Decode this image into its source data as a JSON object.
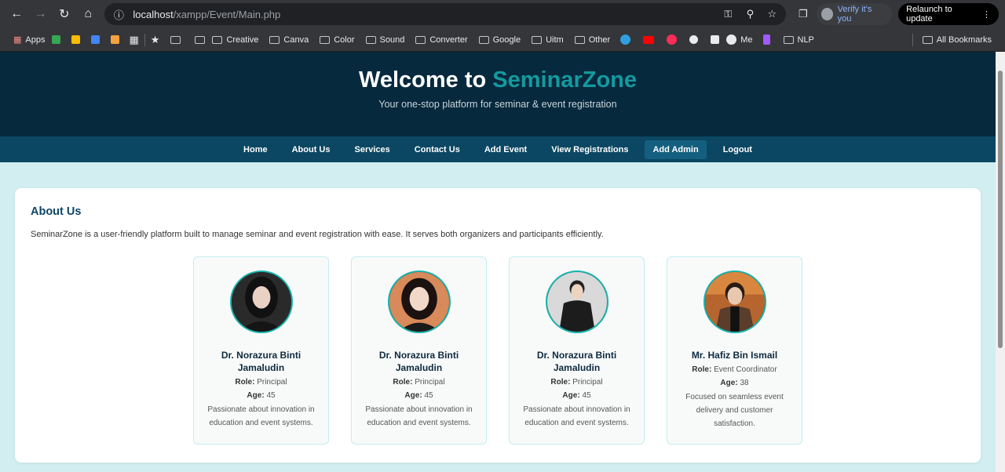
{
  "browser": {
    "url_host": "localhost",
    "url_path": "/xampp/Event/Main.php",
    "profile_label": "Verify it's you",
    "relaunch_label": "Relaunch to update",
    "bookmarks": [
      "Apps",
      "Creative",
      "Canva",
      "Color",
      "Sound",
      "Converter",
      "Google",
      "Uitm",
      "Other",
      "Me",
      "NLP"
    ],
    "all_bookmarks": "All Bookmarks"
  },
  "hero": {
    "title_prefix": "Welcome to ",
    "title_brand": "SeminarZone",
    "subtitle": "Your one-stop platform for seminar & event registration"
  },
  "menu": [
    "Home",
    "About Us",
    "Services",
    "Contact Us",
    "Add Event",
    "View Registrations",
    "Add Admin",
    "Logout"
  ],
  "active_menu": "Add Admin",
  "about": {
    "heading": "About Us",
    "intro": "SeminarZone is a user-friendly platform built to manage seminar and event registration with ease. It serves both organizers and participants efficiently.",
    "members": [
      {
        "name": "Dr. Norazura Binti Jamaludin",
        "role_label": "Role:",
        "role": "Principal",
        "age_label": "Age:",
        "age": "45",
        "bio": "Passionate about innovation in education and event systems."
      },
      {
        "name": "Dr. Norazura Binti Jamaludin",
        "role_label": "Role:",
        "role": "Principal",
        "age_label": "Age:",
        "age": "45",
        "bio": "Passionate about innovation in education and event systems."
      },
      {
        "name": "Dr. Norazura Binti Jamaludin",
        "role_label": "Role:",
        "role": "Principal",
        "age_label": "Age:",
        "age": "45",
        "bio": "Passionate about innovation in education and event systems."
      },
      {
        "name": "Mr. Hafiz Bin Ismail",
        "role_label": "Role:",
        "role": "Event Coordinator",
        "age_label": "Age:",
        "age": "38",
        "bio": "Focused on seamless event delivery and customer satisfaction."
      }
    ]
  },
  "colors": {
    "hero_bg": "#07293d",
    "brand_accent": "#149aa0",
    "menu_bg": "#0b4762",
    "page_bg": "#d2eef1",
    "avatar_ring": "#17b3ad"
  }
}
